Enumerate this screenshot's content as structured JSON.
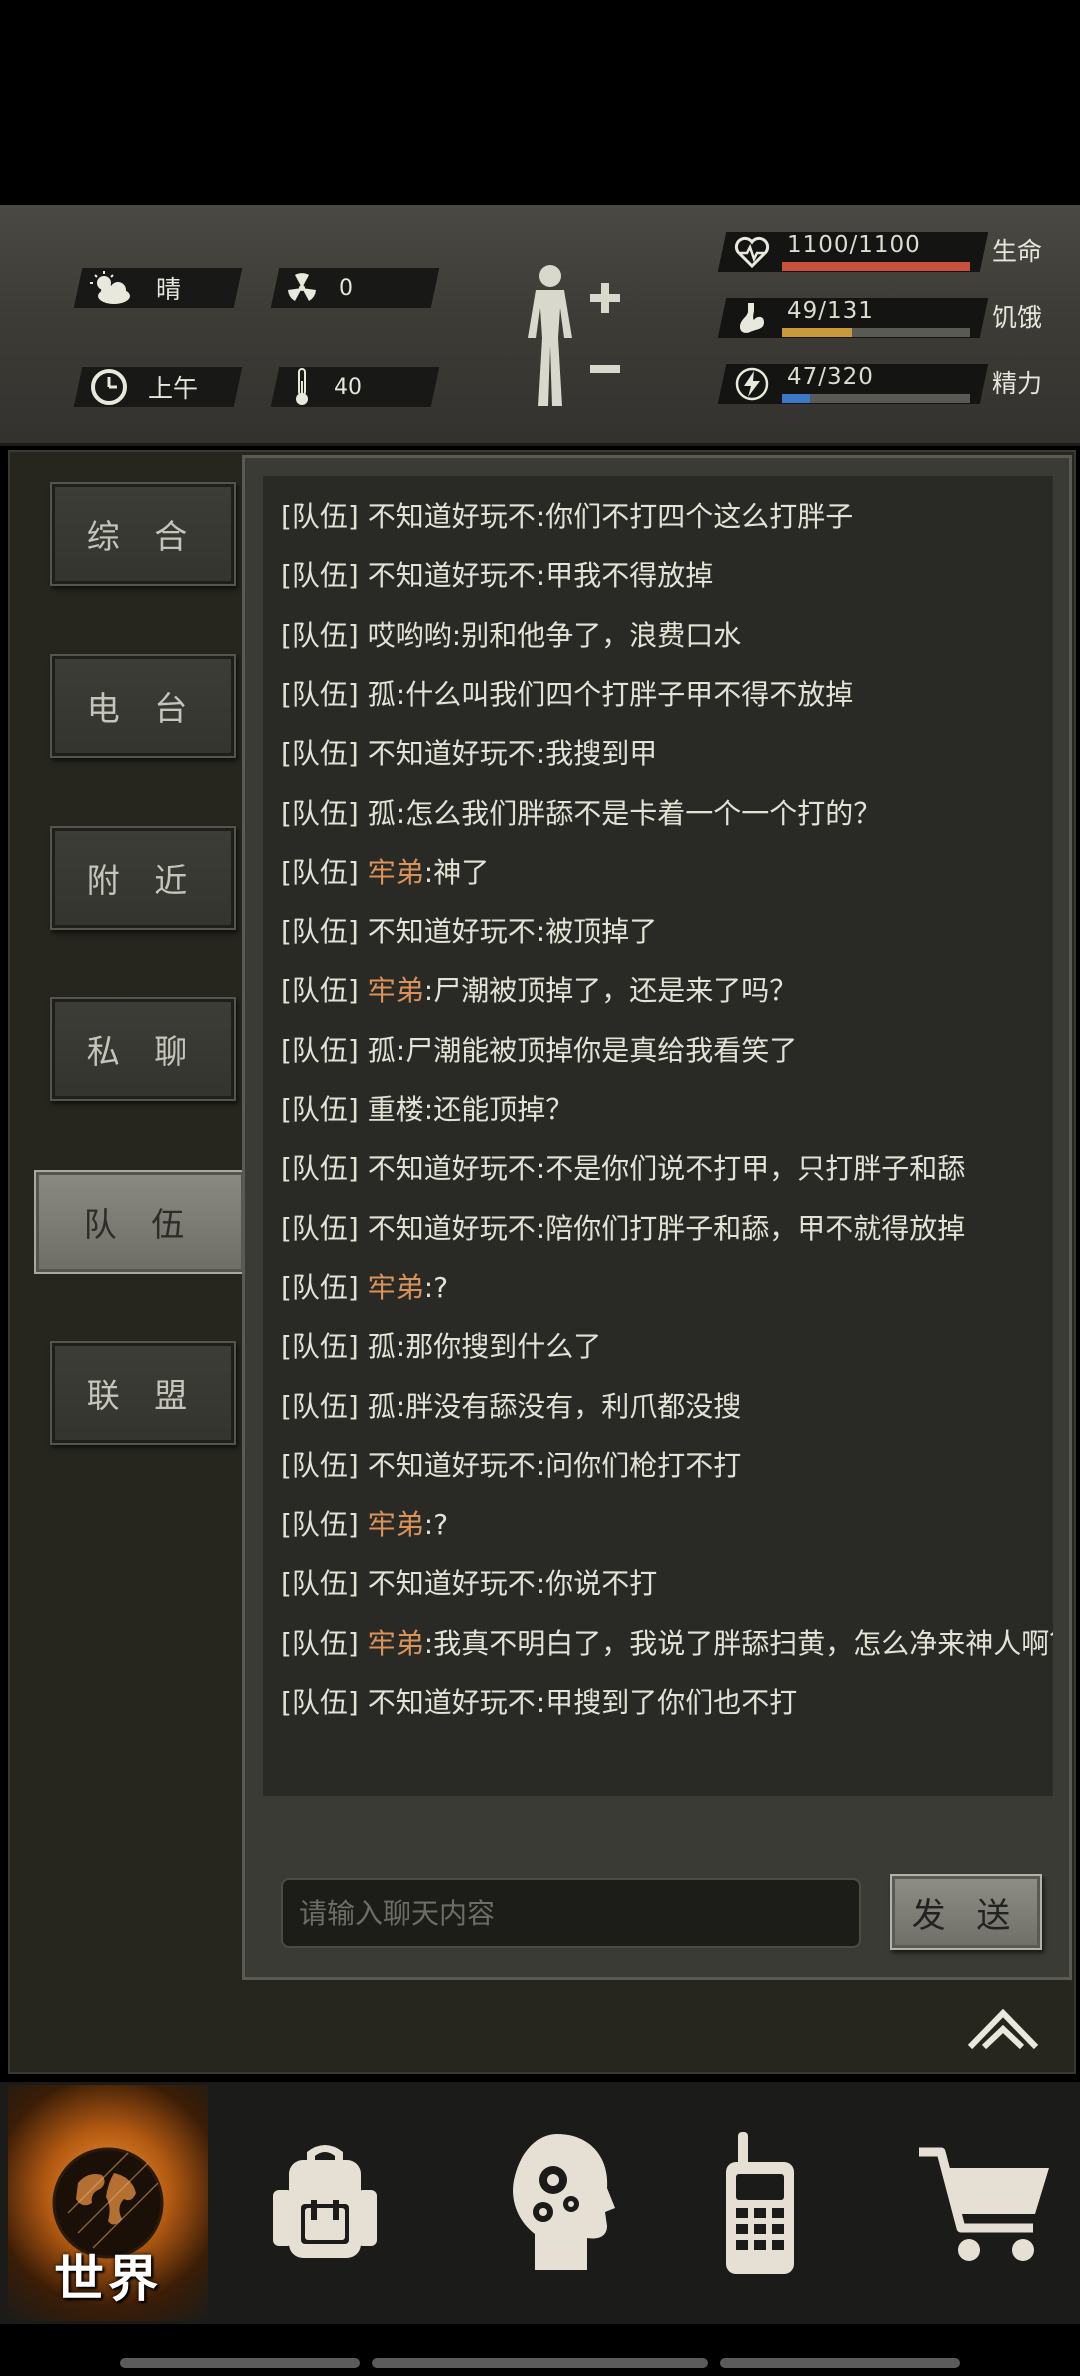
{
  "status": {
    "weather": "晴",
    "radiation": "0",
    "time_of_day": "上午",
    "temperature": "40",
    "health": {
      "text": "1100/1100",
      "label": "生命",
      "fraction": 1.0,
      "color": "#c8503c"
    },
    "hunger": {
      "text": "49/131",
      "label": "饥饿",
      "fraction": 0.374,
      "color": "#c89a3c"
    },
    "energy": {
      "text": "47/320",
      "label": "精力",
      "fraction": 0.147,
      "color": "#3c78c8"
    }
  },
  "tabs": [
    "综 合",
    "电 台",
    "附 近",
    "私 聊",
    "队 伍",
    "联 盟"
  ],
  "chat": {
    "messages": [
      {
        "channel": "[队伍]",
        "name": "不知道好玩不",
        "highlight": false,
        "text": ":你们不打四个这么打胖子"
      },
      {
        "channel": "[队伍]",
        "name": "不知道好玩不",
        "highlight": false,
        "text": ":甲我不得放掉"
      },
      {
        "channel": "[队伍]",
        "name": "哎哟哟",
        "highlight": false,
        "text": ":别和他争了，浪费口水"
      },
      {
        "channel": "[队伍]",
        "name": "孤",
        "highlight": false,
        "text": ":什么叫我们四个打胖子甲不得不放掉"
      },
      {
        "channel": "[队伍]",
        "name": "不知道好玩不",
        "highlight": false,
        "text": ":我搜到甲"
      },
      {
        "channel": "[队伍]",
        "name": "孤",
        "highlight": false,
        "text": ":怎么我们胖舔不是卡着一个一个打的？"
      },
      {
        "channel": "[队伍]",
        "name": "牢弟",
        "highlight": true,
        "text": ":神了"
      },
      {
        "channel": "[队伍]",
        "name": "不知道好玩不",
        "highlight": false,
        "text": ":被顶掉了"
      },
      {
        "channel": "[队伍]",
        "name": "牢弟",
        "highlight": true,
        "text": ":尸潮被顶掉了，还是来了吗？"
      },
      {
        "channel": "[队伍]",
        "name": "孤",
        "highlight": false,
        "text": ":尸潮能被顶掉你是真给我看笑了"
      },
      {
        "channel": "[队伍]",
        "name": "重楼",
        "highlight": false,
        "text": ":还能顶掉？"
      },
      {
        "channel": "[队伍]",
        "name": "不知道好玩不",
        "highlight": false,
        "text": ":不是你们说不打甲，只打胖子和舔"
      },
      {
        "channel": "[队伍]",
        "name": "不知道好玩不",
        "highlight": false,
        "text": ":陪你们打胖子和舔，甲不就得放掉"
      },
      {
        "channel": "[队伍]",
        "name": "牢弟",
        "highlight": true,
        "text": ":?"
      },
      {
        "channel": "[队伍]",
        "name": "孤",
        "highlight": false,
        "text": ":那你搜到什么了"
      },
      {
        "channel": "[队伍]",
        "name": "孤",
        "highlight": false,
        "text": ":胖没有舔没有，利爪都没搜"
      },
      {
        "channel": "[队伍]",
        "name": "不知道好玩不",
        "highlight": false,
        "text": ":问你们枪打不打"
      },
      {
        "channel": "[队伍]",
        "name": "牢弟",
        "highlight": true,
        "text": ":?"
      },
      {
        "channel": "[队伍]",
        "name": "不知道好玩不",
        "highlight": false,
        "text": ":你说不打"
      },
      {
        "channel": "[队伍]",
        "name": "牢弟",
        "highlight": true,
        "text": ":我真不明白了，我说了胖舔扫黄，怎么净来神人啊？"
      },
      {
        "channel": "[队伍]",
        "name": "不知道好玩不",
        "highlight": false,
        "text": ":甲搜到了你们也不打"
      }
    ],
    "input_placeholder": "请输入聊天内容",
    "send_label": "发 送"
  },
  "nav": {
    "world_label": "世界"
  },
  "icons": {
    "weather": "partly-cloudy-icon",
    "radiation": "radiation-icon",
    "time": "clock-icon",
    "temperature": "thermometer-icon",
    "health": "heart-pulse-icon",
    "hunger": "stomach-icon",
    "energy": "lightning-icon",
    "body": "body-figure-icon",
    "collapse": "double-chevron-up-icon",
    "backpack": "backpack-icon",
    "skills": "head-gears-icon",
    "radio": "walkie-talkie-icon",
    "shop": "shopping-cart-icon"
  }
}
